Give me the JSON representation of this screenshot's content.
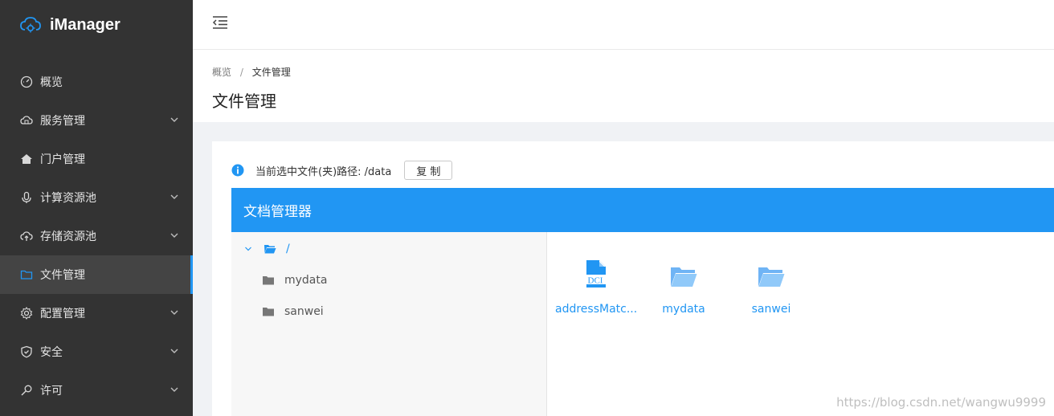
{
  "app": {
    "name": "iManager"
  },
  "sidebar": {
    "items": [
      {
        "label": "概览",
        "icon": "dashboard-icon",
        "expandable": false,
        "active": false
      },
      {
        "label": "服务管理",
        "icon": "cloud-service-icon",
        "expandable": true,
        "active": false
      },
      {
        "label": "门户管理",
        "icon": "home-icon",
        "expandable": false,
        "active": false
      },
      {
        "label": "计算资源池",
        "icon": "microphone-icon",
        "expandable": true,
        "active": false
      },
      {
        "label": "存储资源池",
        "icon": "cloud-upload-icon",
        "expandable": true,
        "active": false
      },
      {
        "label": "文件管理",
        "icon": "folder-icon",
        "expandable": false,
        "active": true
      },
      {
        "label": "配置管理",
        "icon": "gear-icon",
        "expandable": true,
        "active": false
      },
      {
        "label": "安全",
        "icon": "shield-icon",
        "expandable": true,
        "active": false
      },
      {
        "label": "许可",
        "icon": "key-icon",
        "expandable": true,
        "active": false
      }
    ]
  },
  "breadcrumb": {
    "home": "概览",
    "separator": "/",
    "current": "文件管理"
  },
  "page": {
    "title": "文件管理"
  },
  "path_bar": {
    "text": "当前选中文件(夹)路径: /data",
    "copy_label": "复 制"
  },
  "file_manager": {
    "title": "文档管理器",
    "tree": {
      "root": "/",
      "children": [
        "mydata",
        "sanwei"
      ]
    },
    "files": [
      {
        "name": "addressMatc...",
        "type": "dci-file",
        "icon_text": "DCI"
      },
      {
        "name": "mydata",
        "type": "folder"
      },
      {
        "name": "sanwei",
        "type": "folder"
      }
    ]
  },
  "watermark": "https://blog.csdn.net/wangwu9999",
  "colors": {
    "accent": "#2196f3",
    "sidebar_bg": "#333333",
    "folder": "#6fb4f5"
  }
}
